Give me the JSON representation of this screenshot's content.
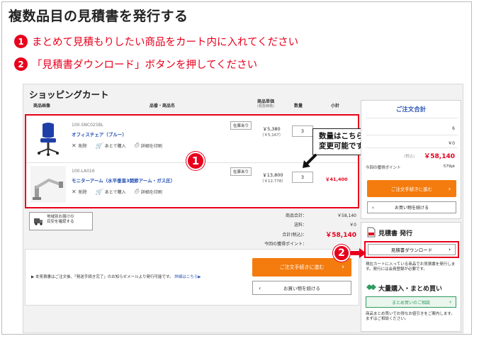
{
  "title": "複数品目の見積書を発行する",
  "steps": [
    {
      "num": "1",
      "text": "まとめて見積もりしたい商品をカート内に入れてください"
    },
    {
      "num": "2",
      "text": "「見積書ダウンロード」ボタンを押してください"
    }
  ],
  "cart": {
    "title": "ショッピングカート",
    "headers": {
      "image": "商品画像",
      "name": "品番・商品名",
      "price": "商品単価",
      "price_sub": "(税抜価格)",
      "qty": "数量",
      "subtotal": "小計"
    },
    "items": [
      {
        "code": "100-SNC025BL",
        "name": "オフィスチェア（ブルー）",
        "stock": "在庫あり",
        "price": "￥5,380",
        "price_ex": "（￥5,167）",
        "qty": "3",
        "subtotal": ""
      },
      {
        "code": "100-LA016",
        "name": "モニターアーム（水平垂直3関節アーム・ガス圧）",
        "stock": "在庫あり",
        "price": "￥13,800",
        "price_ex": "（￥12,778）",
        "qty": "3",
        "subtotal": "￥41,400"
      }
    ],
    "actions": {
      "delete": "削除",
      "later": "あとで購入",
      "print": "詳細を印刷"
    },
    "callout_line1": "数量はこちらで",
    "callout_line2": "変更可能です",
    "region_btn_line1": "地域別お届けの",
    "region_btn_line2": "目安を確認する",
    "totals": {
      "product_total_label": "商品合計：",
      "product_total": "￥58,140",
      "shipping_label": "送料：",
      "shipping": "￥0",
      "total_label": "合計(税込)：",
      "total": "￥58,140",
      "points_label": "今回の獲得ポイント："
    },
    "notice": "▶ 本見積書はご注文後、「発送手続き完了」のお知らせメールより発行可能です。",
    "notice_link": "詳細はこちら▶",
    "proceed_label": "ご注文手続きに進む",
    "continue_label": "お買い物を続ける"
  },
  "summary": {
    "title": "ご注文合計",
    "qty": "6",
    "shipping": "￥0",
    "total_label": "(税込)",
    "total": "￥58,140",
    "points_label": "今回の獲得ポイント",
    "points": "579pt",
    "proceed_label": "ご注文手続きに進む",
    "continue_label": "お買い物を続ける"
  },
  "quote": {
    "title": "見積書 発行",
    "button": "見積書ダウンロード",
    "desc": "現在カートに入っている商品でお見積書を発行します。発行には会員登録が必要です。",
    "bulk_title": "大量購入・まとめ買い",
    "bulk_button": "まとめ買いのご相談",
    "bulk_desc": "商品まとめ買いでお得なお値引きをご案内します。まずはご相談ください。"
  },
  "badges": {
    "one": "1",
    "two": "2"
  },
  "colors": {
    "accent_red": "#e8001c",
    "orange": "#f47b0d",
    "link_blue": "#2450b4",
    "green": "#2e9c5e"
  }
}
